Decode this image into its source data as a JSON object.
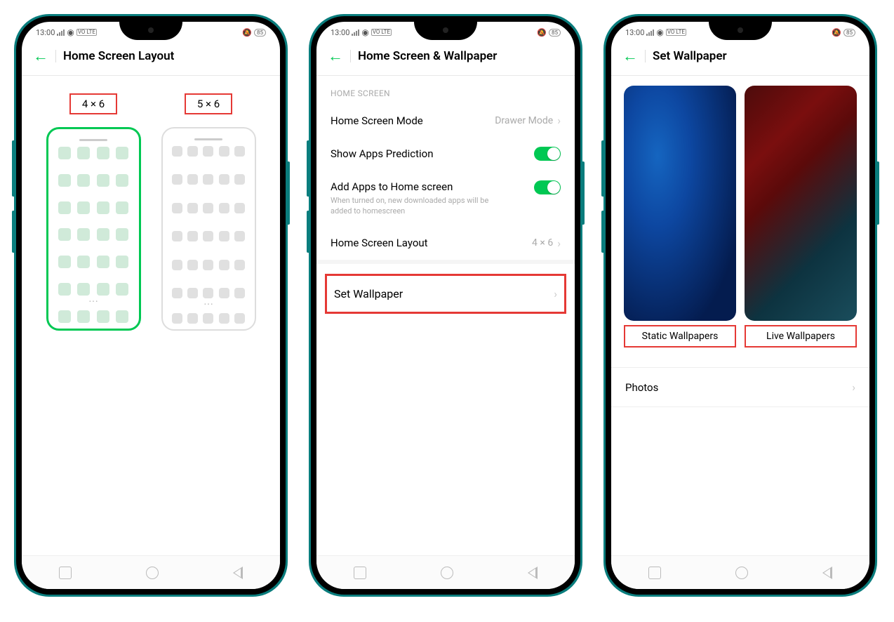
{
  "status": {
    "time": "13:00",
    "volte": "VO\nLTE",
    "battery": "85"
  },
  "screen1": {
    "title": "Home Screen Layout",
    "option1": "4 × 6",
    "option2": "5 × 6"
  },
  "screen2": {
    "title": "Home Screen & Wallpaper",
    "section": "HOME SCREEN",
    "row1_label": "Home Screen Mode",
    "row1_value": "Drawer Mode",
    "row2_label": "Show Apps Prediction",
    "row3_label": "Add Apps to Home screen",
    "row3_sub": "When turned on, new downloaded apps will be added to homescreen",
    "row4_label": "Home Screen Layout",
    "row4_value": "4 × 6",
    "row5_label": "Set Wallpaper"
  },
  "screen3": {
    "title": "Set Wallpaper",
    "static_label": "Static Wallpapers",
    "live_label": "Live Wallpapers",
    "photos_label": "Photos"
  }
}
